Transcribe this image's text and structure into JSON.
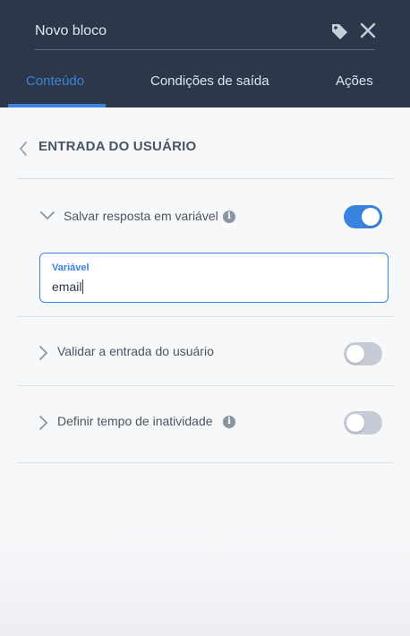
{
  "header": {
    "title": "Novo bloco",
    "icons": [
      "tag-icon",
      "close-icon"
    ],
    "tabs": [
      {
        "label": "Conteúdo",
        "active": true
      },
      {
        "label": "Condições de saída",
        "active": false
      },
      {
        "label": "Ações",
        "active": false
      }
    ]
  },
  "section": {
    "title": "ENTRADA DO USUÁRIO"
  },
  "options": [
    {
      "label": "Salvar resposta em variável",
      "expanded": true,
      "has_info": true,
      "enabled": true
    },
    {
      "label": "Validar a entrada do usuário",
      "expanded": false,
      "has_info": false,
      "enabled": false
    },
    {
      "label": "Definir tempo de inatividade",
      "expanded": false,
      "has_info": true,
      "enabled": false
    }
  ],
  "variable_field": {
    "label": "Variável",
    "value": "email"
  },
  "colors": {
    "header_bg": "#2c3849",
    "accent": "#3a82e0",
    "toggle_off": "#c5ccd5",
    "text": "#4a5563"
  }
}
